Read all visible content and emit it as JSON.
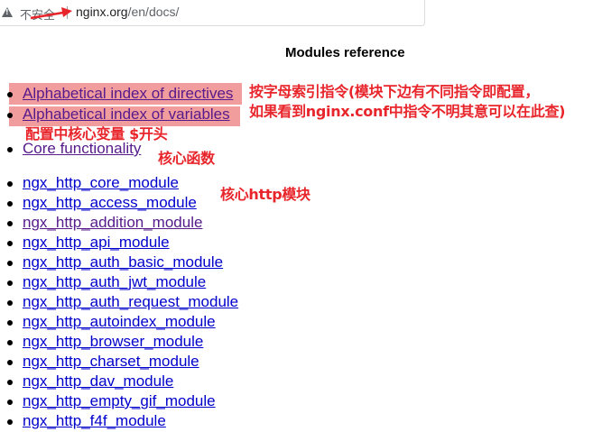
{
  "browser": {
    "security_label": "不安全",
    "url_host": "nginx.org",
    "url_path": "/en/docs/"
  },
  "page": {
    "heading": "Modules reference"
  },
  "reference_links": [
    {
      "label": "Alphabetical index of directives"
    },
    {
      "label": "Alphabetical index of variables"
    },
    {
      "label": "Core functionality"
    }
  ],
  "modules": [
    {
      "label": "ngx_http_core_module"
    },
    {
      "label": "ngx_http_access_module"
    },
    {
      "label": "ngx_http_addition_module"
    },
    {
      "label": "ngx_http_api_module"
    },
    {
      "label": "ngx_http_auth_basic_module"
    },
    {
      "label": "ngx_http_auth_jwt_module"
    },
    {
      "label": "ngx_http_auth_request_module"
    },
    {
      "label": "ngx_http_autoindex_module"
    },
    {
      "label": "ngx_http_browser_module"
    },
    {
      "label": "ngx_http_charset_module"
    },
    {
      "label": "ngx_http_dav_module"
    },
    {
      "label": "ngx_http_empty_gif_module"
    },
    {
      "label": "ngx_http_f4f_module"
    }
  ],
  "annotations": {
    "directives_note_line1": "按字母索引指令(模块下边有不同指令即配置，",
    "directives_note_line2": "如果看到nginx.conf中指令不明其意可以在此查)",
    "variables_note": "配置中核心变量 $开头",
    "core_note": "核心函数",
    "http_note": "核心http模块",
    "color": "#e8252b"
  }
}
